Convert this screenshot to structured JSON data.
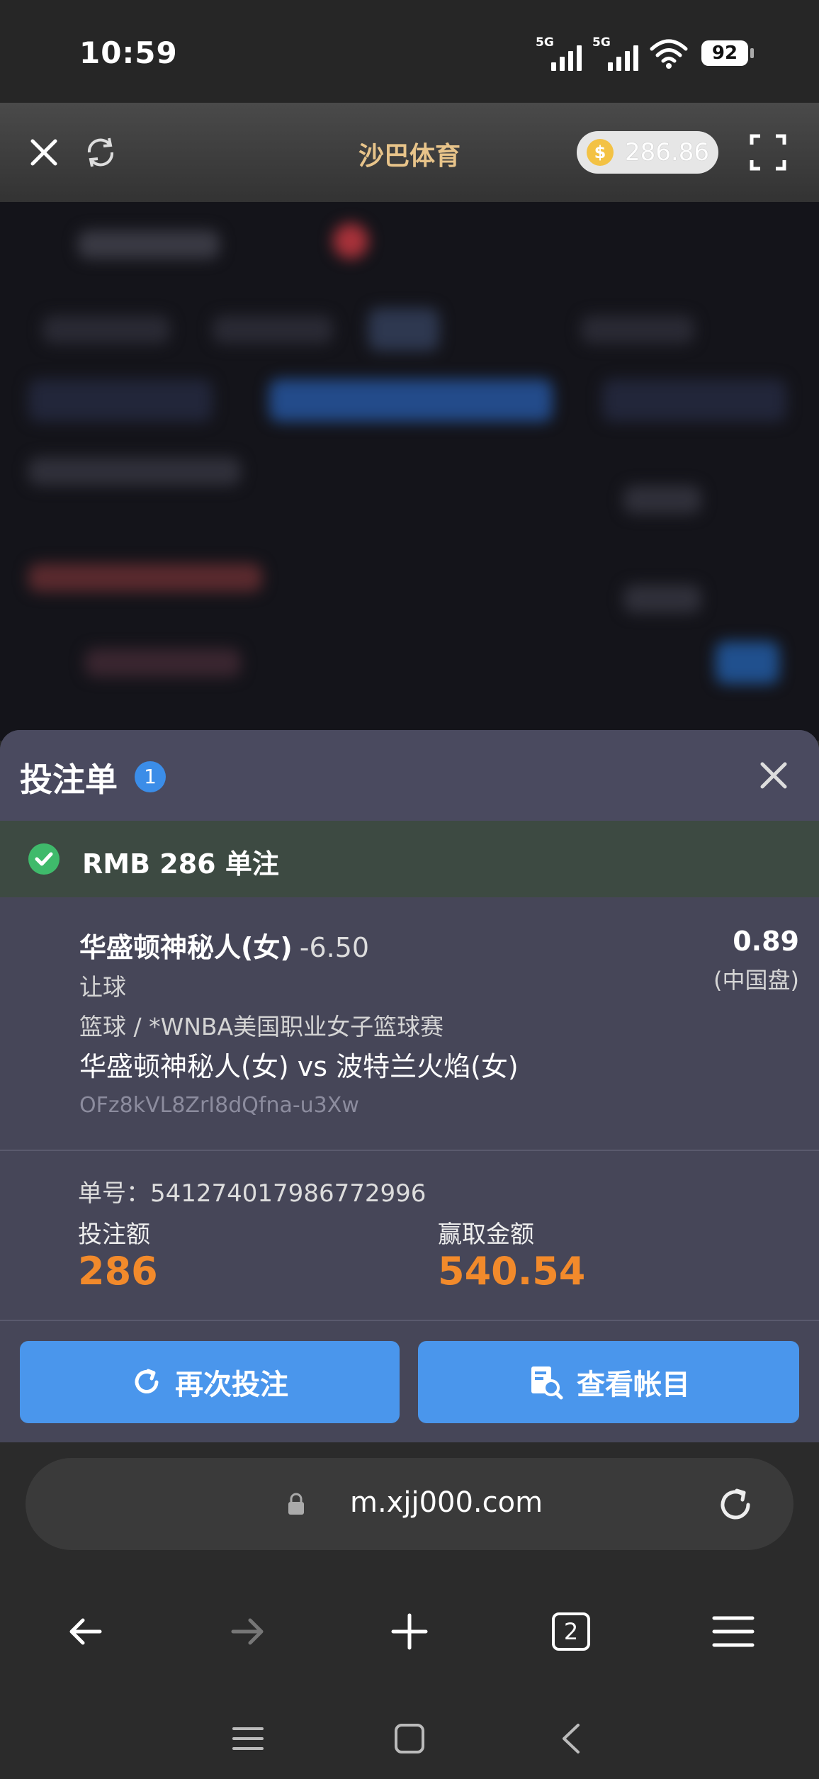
{
  "status_bar": {
    "time": "10:59",
    "signal1_tag": "5G",
    "signal2_tag": "5G",
    "battery": "92"
  },
  "header": {
    "title": "沙巴体育",
    "coin_symbol": "$",
    "balance": "286.86",
    "close_icon": "close-icon",
    "refresh_icon": "refresh-icon",
    "fullscreen_icon": "fullscreen-icon"
  },
  "bet_slip": {
    "title": "投注单",
    "count": "1",
    "status_text": "RMB 286 单注",
    "selection": {
      "team": "华盛顿神秘人(女)",
      "line": "-6.50",
      "odds": "0.89",
      "odds_type": "(中国盘)",
      "market": "让球",
      "league": "篮球 / *WNBA美国职业女子篮球赛",
      "match": "华盛顿神秘人(女) vs 波特兰火焰(女)",
      "ref_code": "OFz8kVL8ZrI8dQfna-u3Xw"
    },
    "ticket": {
      "number_label": "单号：541274017986772996",
      "stake_label": "投注额",
      "stake_value": "286",
      "win_label": "赢取金额",
      "win_value": "540.54"
    },
    "actions": {
      "rebet_label": "再次投注",
      "statement_label": "查看帐目"
    }
  },
  "browser": {
    "url": "m.xjj000.com",
    "tab_count": "2"
  },
  "colors": {
    "accent_blue": "#4a96ec",
    "amount_orange": "#f28a2b",
    "title_gold": "#e8c48a",
    "success_green": "#3fba6b"
  }
}
